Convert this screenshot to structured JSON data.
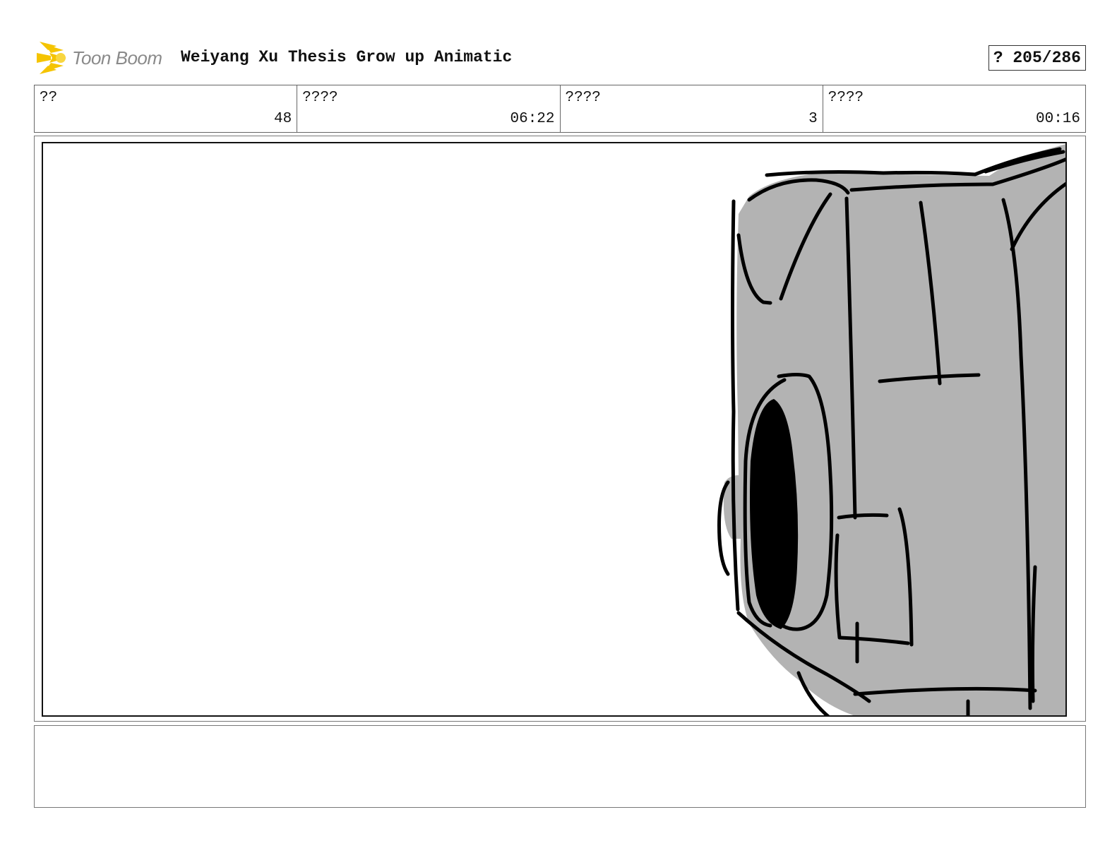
{
  "header": {
    "logo_text": "Toon Boom",
    "title": "Weiyang Xu Thesis Grow up Animatic",
    "page_counter": "? 205/286"
  },
  "info_cells": [
    {
      "label": "??",
      "value": "48"
    },
    {
      "label": "????",
      "value": "06:22"
    },
    {
      "label": "????",
      "value": "3"
    },
    {
      "label": "????",
      "value": "00:16"
    }
  ],
  "panel": {
    "sketch_icon": "camera-sketch-icon",
    "fill_color": "#b3b3b3",
    "stroke_color": "#000000"
  },
  "colors": {
    "logo_burst": "#f5c400",
    "logo_text": "#8a8a8a",
    "border": "#666666"
  }
}
